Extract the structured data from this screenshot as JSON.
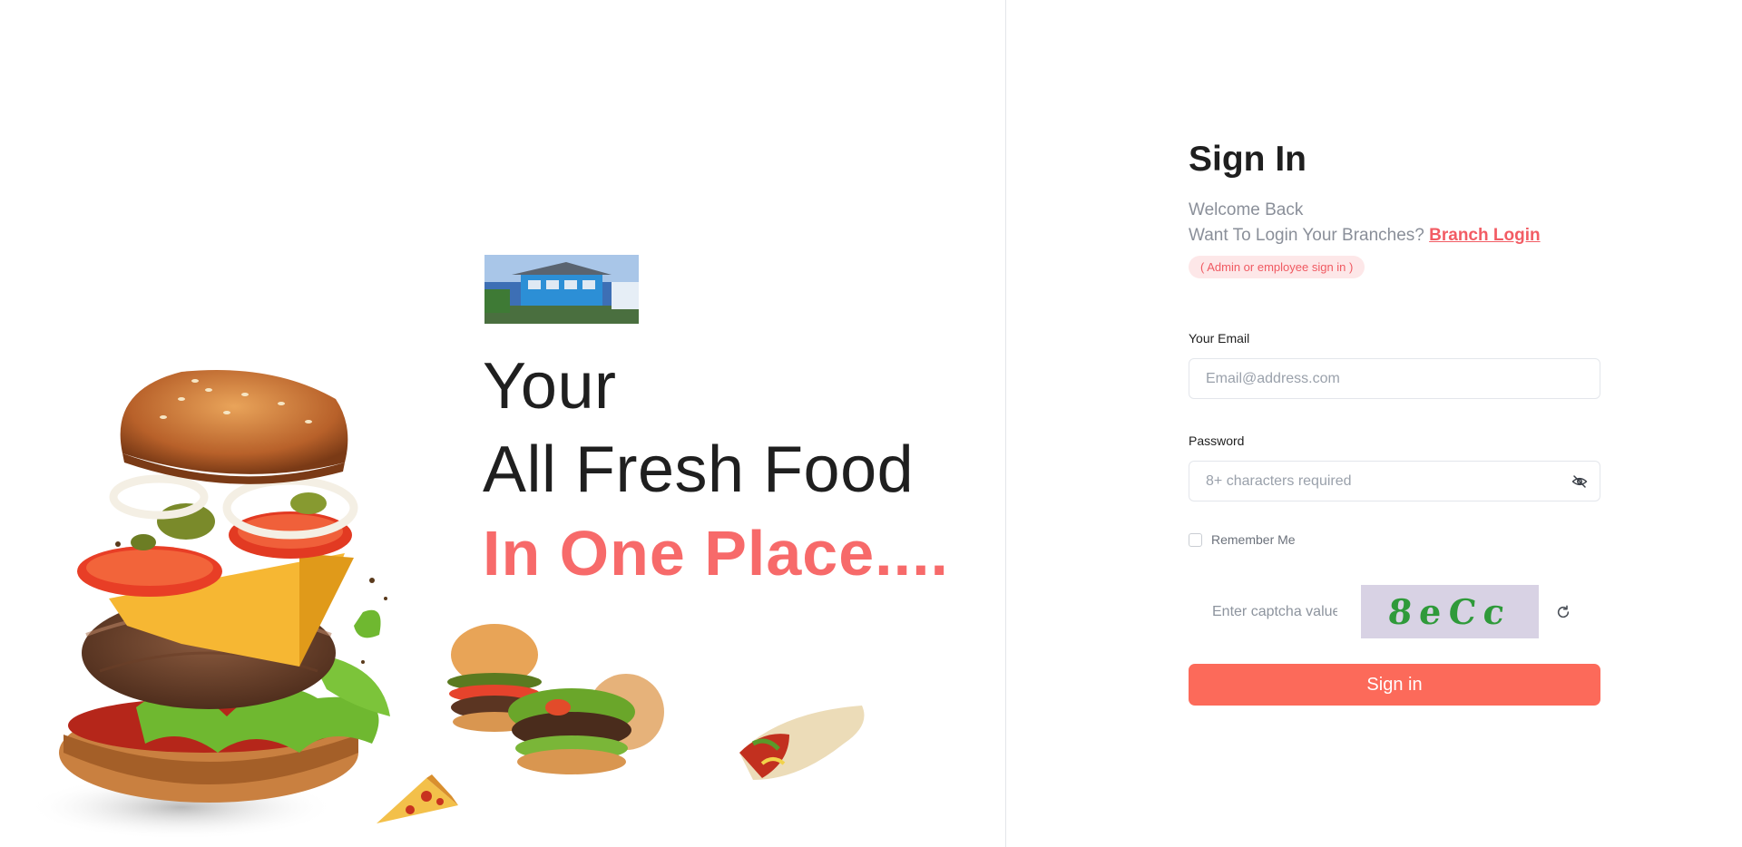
{
  "hero": {
    "line1": "Your",
    "line2": "All Fresh Food",
    "line3": "In One Place....",
    "accent_color": "#f76a6a"
  },
  "form": {
    "title": "Sign In",
    "welcome": "Welcome Back",
    "branch_prompt": "Want To Login Your Branches?",
    "branch_link": "Branch Login",
    "role_badge": "( Admin or employee sign in )",
    "email_label": "Your Email",
    "email_placeholder": "Email@address.com",
    "password_label": "Password",
    "password_placeholder": "8+ characters required",
    "remember_label": "Remember Me",
    "captcha_placeholder": "Enter captcha value",
    "captcha_code": "8eCc",
    "submit_label": "Sign in",
    "button_color": "#fc6a5a"
  },
  "icons": {
    "password_toggle": "eye-off-icon",
    "captcha_refresh": "refresh-icon"
  }
}
